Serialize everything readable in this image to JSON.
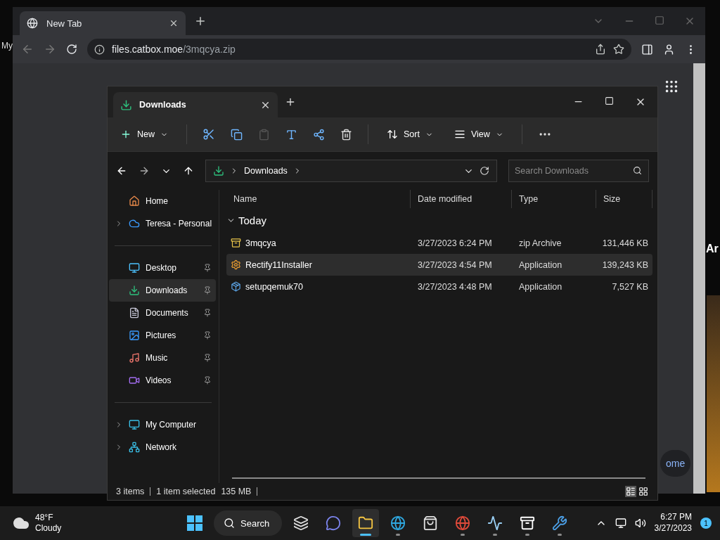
{
  "desktop": {
    "label": "My",
    "side_heading": "Ar"
  },
  "browser": {
    "tab": {
      "title": "New Tab"
    },
    "url": {
      "host": "files.catbox.moe",
      "path": "/3mqcya.zip"
    },
    "page_button": "ome"
  },
  "explorer": {
    "tab": {
      "title": "Downloads"
    },
    "toolbar": {
      "new": "New",
      "sort": "Sort",
      "view": "View"
    },
    "breadcrumb": "Downloads",
    "search": {
      "placeholder": "Search Downloads"
    },
    "sidebar": {
      "sections": [
        [
          {
            "label": "Home",
            "selected": false,
            "pinned": false,
            "expandable": false
          },
          {
            "label": "Teresa - Personal",
            "selected": false,
            "pinned": false,
            "expandable": true
          }
        ],
        [
          {
            "label": "Desktop",
            "selected": false,
            "pinned": true,
            "expandable": false
          },
          {
            "label": "Downloads",
            "selected": true,
            "pinned": true,
            "expandable": false
          },
          {
            "label": "Documents",
            "selected": false,
            "pinned": true,
            "expandable": false
          },
          {
            "label": "Pictures",
            "selected": false,
            "pinned": true,
            "expandable": false
          },
          {
            "label": "Music",
            "selected": false,
            "pinned": true,
            "expandable": false
          },
          {
            "label": "Videos",
            "selected": false,
            "pinned": true,
            "expandable": false
          }
        ],
        [
          {
            "label": "My Computer",
            "selected": false,
            "pinned": false,
            "expandable": true
          },
          {
            "label": "Network",
            "selected": false,
            "pinned": false,
            "expandable": true
          }
        ]
      ]
    },
    "table": {
      "columns": [
        "Name",
        "Date modified",
        "Type",
        "Size"
      ],
      "group": {
        "label": "Today",
        "expanded": true
      },
      "rows": [
        {
          "kind": "archive",
          "name": "3mqcya",
          "date": "3/27/2023 6:24 PM",
          "type": "zip Archive",
          "size": "131,446 KB",
          "selected": false
        },
        {
          "kind": "installer",
          "name": "Rectify11Installer",
          "date": "3/27/2023 4:54 PM",
          "type": "Application",
          "size": "139,243 KB",
          "selected": true
        },
        {
          "kind": "setup",
          "name": "setupqemuk70",
          "date": "3/27/2023 4:48 PM",
          "type": "Application",
          "size": "7,527 KB",
          "selected": false
        }
      ]
    },
    "status_bar": {
      "count": "3 items",
      "selection": "1 item selected",
      "size": "135 MB"
    }
  },
  "taskbar": {
    "weather": {
      "temperature": "48°F",
      "condition": "Cloudy"
    },
    "search": "Search",
    "apps": [
      {
        "kind": "task-view",
        "running": false,
        "active": false
      },
      {
        "kind": "chat",
        "running": false,
        "active": false
      },
      {
        "kind": "folder",
        "running": true,
        "active": true
      },
      {
        "kind": "edge",
        "running": true,
        "active": false
      },
      {
        "kind": "store",
        "running": false,
        "active": false
      },
      {
        "kind": "chrome",
        "running": true,
        "active": false
      },
      {
        "kind": "monitor",
        "running": true,
        "active": false
      },
      {
        "kind": "zip",
        "running": true,
        "active": false
      },
      {
        "kind": "tool",
        "running": true,
        "active": false
      }
    ],
    "time": "6:27 PM",
    "date": "3/27/2023",
    "notifications": "1"
  }
}
